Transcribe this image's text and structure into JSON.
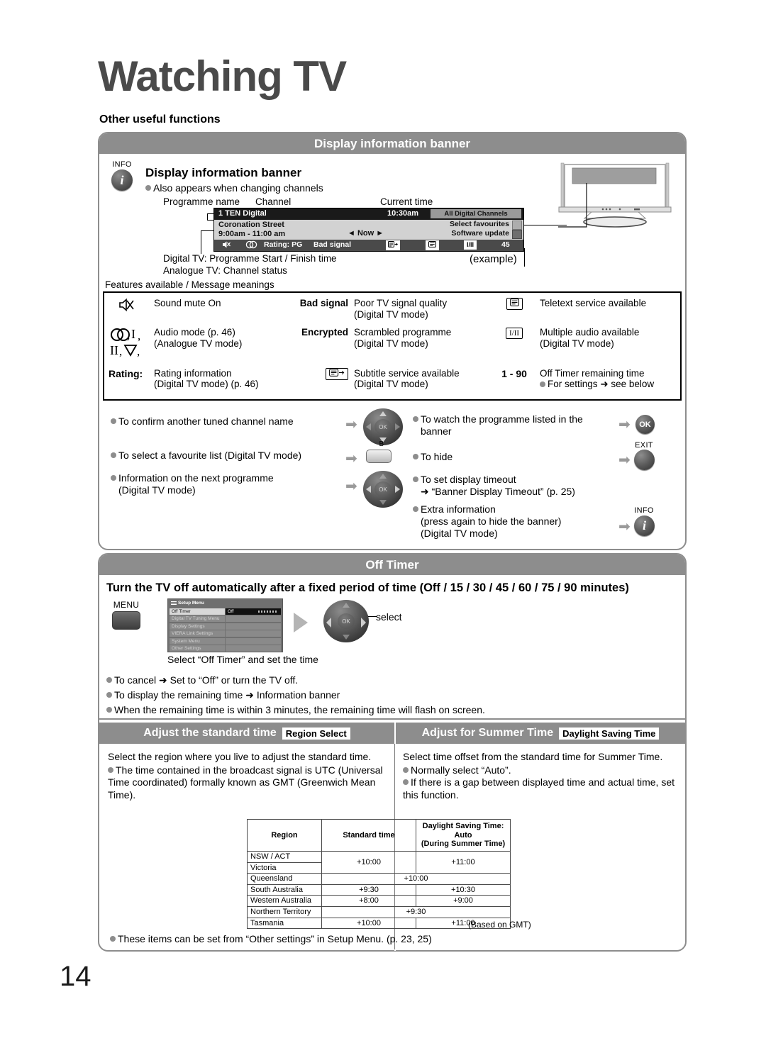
{
  "page": {
    "title": "Watching TV",
    "subtitle": "Other useful functions",
    "number": "14"
  },
  "section_banner": {
    "header": "Display information banner",
    "button_label": "INFO",
    "heading": "Display information banner",
    "note": "Also appears when changing channels",
    "callouts": {
      "programme_name": "Programme name",
      "channel": "Channel",
      "current_time": "Current time",
      "digital_line": "Digital TV: Programme Start / Finish time",
      "analogue_line": "Analogue TV: Channel status",
      "example": "(example)"
    },
    "tv_banner": {
      "channel_number_name": "1 TEN Digital",
      "time": "10:30am",
      "channel_list": "All Digital Channels",
      "programme": "Coronation Street",
      "programme_times": "9:00am - 11:00 am",
      "now": "Now",
      "now_left_arrow": "◄",
      "now_right_arrow": "►",
      "select_favourites": "Select favourites",
      "software_update": "Software update",
      "rating": "Rating: PG",
      "bad_signal": "Bad signal",
      "audio_icon": "I/II",
      "timer_value": "45"
    },
    "features_title": "Features available / Message meanings",
    "features": [
      {
        "left_icon": "sound-mute-icon",
        "left_text": "Sound mute On",
        "mid_label": "Bad signal",
        "mid_text": "Poor TV signal quality",
        "mid_sub": "(Digital TV mode)",
        "right_icon": "teletext-icon",
        "right_text": "Teletext service available",
        "right_sub": ""
      },
      {
        "left_icon": "audio-mode-icon",
        "left_text": "Audio mode (p. 46)",
        "left_sub": "(Analogue TV mode)",
        "mid_label": "Encrypted",
        "mid_text": "Scrambled programme",
        "mid_sub": "(Digital TV mode)",
        "right_icon": "I/II",
        "right_text": "Multiple audio available",
        "right_sub": "(Digital TV mode)"
      },
      {
        "left_icon": "Rating:",
        "left_text": "Rating information",
        "left_sub": "(Digital TV mode) (p. 46)",
        "mid_label": "subtitle-icon",
        "mid_text": "Subtitle service available",
        "mid_sub": "(Digital TV mode)",
        "right_icon": "1 - 90",
        "right_text": "Off Timer remaining time",
        "right_sub": "For settings ➜ see below"
      }
    ],
    "instructions_left": [
      {
        "text": "To confirm another tuned channel name",
        "control": "dpad-updown"
      },
      {
        "text": "To select a favourite list (Digital TV mode)",
        "control": "b-button",
        "control_label": "B"
      },
      {
        "text": "Information on the next programme",
        "text2": "(Digital TV mode)",
        "control": "dpad-leftright"
      }
    ],
    "instructions_right": [
      {
        "text": "To watch the programme listed in the",
        "text2": "banner",
        "control": "ok-button",
        "control_label": "OK"
      },
      {
        "text": "To hide",
        "control": "exit-button",
        "control_label": "EXIT"
      },
      {
        "text": "To set display timeout",
        "text2": "➜ “Banner Display Timeout” (p. 25)"
      },
      {
        "text": "Extra information",
        "text2": "(press again to hide the banner)",
        "text3": "(Digital TV mode)",
        "control": "info-button",
        "control_label": "INFO"
      }
    ]
  },
  "section_off_timer": {
    "header": "Off Timer",
    "lead": "Turn the TV off automatically after a fixed period of time (Off / 15 / 30 / 45 / 60 / 75 / 90 minutes)",
    "menu_button_label": "MENU",
    "setup_menu": {
      "title": "Setup Menu",
      "rows": [
        {
          "label": "Off Timer",
          "value": "Off",
          "selected": true
        },
        {
          "label": "Digital TV Tuning Menu",
          "value": "",
          "selected": false
        },
        {
          "label": "Display Settings",
          "value": "",
          "selected": false
        },
        {
          "label": "VIERA Link Settings",
          "value": "",
          "selected": false
        },
        {
          "label": "System Menu",
          "value": "",
          "selected": false
        },
        {
          "label": "Other Settings",
          "value": "",
          "selected": false
        }
      ]
    },
    "select_label": "select",
    "caption": "Select “Off Timer” and set the time",
    "notes": [
      "To cancel ➜ Set to “Off” or turn the TV off.",
      "To display the remaining time ➜ Information banner",
      "When the remaining time is within 3 minutes, the remaining time will flash on screen."
    ]
  },
  "section_time": {
    "left_header": "Adjust the standard time",
    "left_header_box": "Region Select",
    "right_header": "Adjust for Summer Time",
    "right_header_box": "Daylight Saving Time",
    "left_body": "Select the region where you live to adjust the standard time.",
    "left_bullets": [
      "The time contained in the broadcast signal is UTC (Universal Time coordinated) formally known as GMT (Greenwich Mean Time)."
    ],
    "right_body": "Select time offset from the standard time for Summer Time.",
    "right_bullets": [
      "Normally select “Auto”.",
      "If there is a gap between displayed time and actual time, set this function."
    ],
    "table": {
      "headers": [
        "Region",
        "Standard time",
        "Daylight Saving Time: Auto (During Summer Time)"
      ],
      "header3_line1": "Daylight Saving Time: Auto",
      "header3_line2": "(During Summer Time)",
      "rows": [
        {
          "region": "NSW / ACT",
          "standard": "+10:00",
          "dst": "+11:00",
          "merge_standard_rows": 2
        },
        {
          "region": "Victoria",
          "standard": "",
          "dst": ""
        },
        {
          "region": "Queensland",
          "standard": "+10:00",
          "dst": "",
          "span": true
        },
        {
          "region": "South Australia",
          "standard": "+9:30",
          "dst": "+10:30"
        },
        {
          "region": "Western Australia",
          "standard": "+8:00",
          "dst": "+9:00"
        },
        {
          "region": "Northern Territory",
          "standard": "+9:30",
          "dst": "",
          "span": true
        },
        {
          "region": "Tasmania",
          "standard": "+10:00",
          "dst": "+11:00"
        }
      ]
    },
    "gmt_note": "(Based on GMT)",
    "footnote": "These items can be set from “Other settings” in Setup Menu. (p. 23, 25)"
  }
}
